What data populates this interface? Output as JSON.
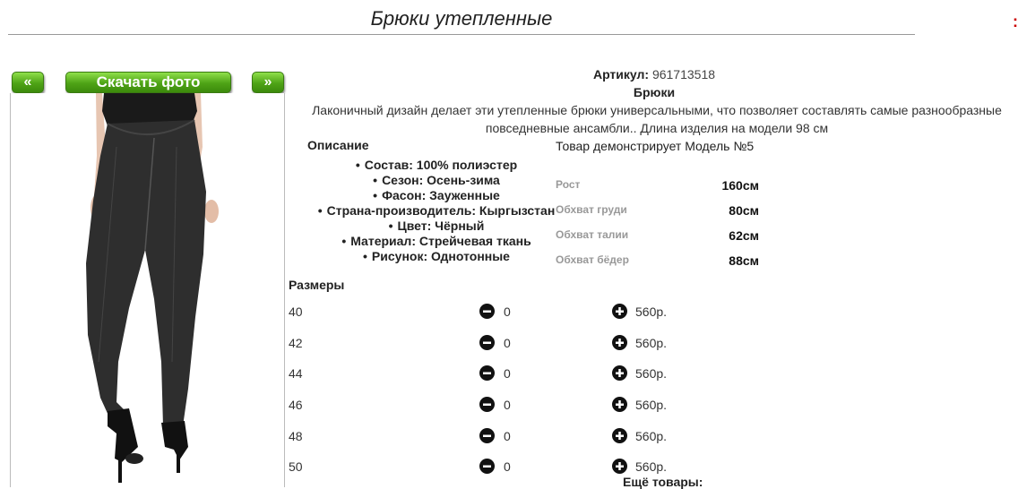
{
  "page": {
    "title": "Брюки утепленные"
  },
  "buttons": {
    "prev": "«",
    "download": "Скачать фото",
    "next": "»"
  },
  "product": {
    "article_label": "Артикул:",
    "article_value": "961713518",
    "type": "Брюки",
    "description": "Лаконичный дизайн делает эти утепленные брюки универсальными, что позволяет составлять самые разнообразные повседневные ансамбли.. Длина изделия на модели 98 см"
  },
  "description_section": {
    "heading": "Описание",
    "items": [
      "Состав: 100% полиэстер",
      "Сезон: Осень-зима",
      "Фасон: Зауженные",
      "Страна-производитель: Кыргызстан",
      "Цвет: Чёрный",
      "Материал: Стрейчевая ткань",
      "Рисунок: Однотонные"
    ]
  },
  "model": {
    "title": "Товар демонстрирует Модель №5",
    "measurements": [
      {
        "label": "Рост",
        "value": "160см"
      },
      {
        "label": "Обхват груди",
        "value": "80см"
      },
      {
        "label": "Обхват талии",
        "value": "62см"
      },
      {
        "label": "Обхват бёдер",
        "value": "88см"
      }
    ]
  },
  "sizes": {
    "heading": "Размеры",
    "rows": [
      {
        "size": "40",
        "qty": "0",
        "price": "560р."
      },
      {
        "size": "42",
        "qty": "0",
        "price": "560р."
      },
      {
        "size": "44",
        "qty": "0",
        "price": "560р."
      },
      {
        "size": "46",
        "qty": "0",
        "price": "560р."
      },
      {
        "size": "48",
        "qty": "0",
        "price": "560р."
      },
      {
        "size": "50",
        "qty": "0",
        "price": "560р."
      }
    ]
  },
  "more_products": "Ещё товары:",
  "icons": {
    "minus": "minus-circle-icon",
    "plus": "plus-circle-icon"
  },
  "colors": {
    "button_green": "#4ea316",
    "rule": "#999999"
  }
}
